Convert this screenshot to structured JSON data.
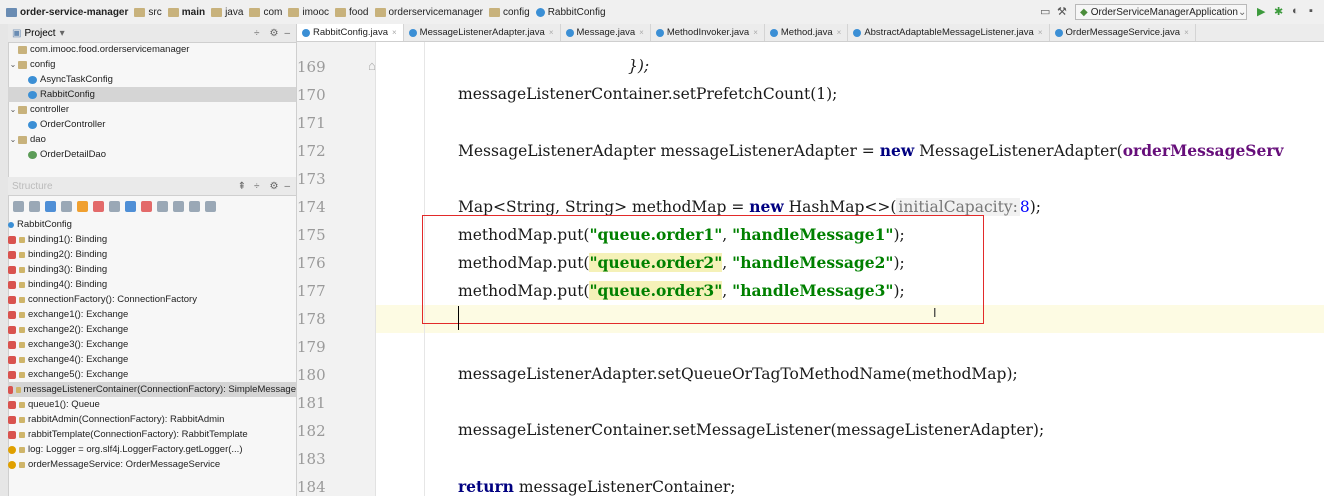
{
  "navbar": {
    "breadcrumbs": [
      "order-service-manager",
      "src",
      "main",
      "java",
      "com",
      "imooc",
      "food",
      "orderservicemanager",
      "config",
      "RabbitConfig"
    ],
    "run_config": "OrderServiceManagerApplication"
  },
  "left_panel": {
    "project_title": "Project",
    "project_tree": [
      {
        "label": "com.imooc.food.orderservicemanager",
        "icon": "folder-icon"
      },
      {
        "label": "config",
        "icon": "folder-icon"
      },
      {
        "label": "AsyncTaskConfig",
        "icon": "class-icon"
      },
      {
        "label": "RabbitConfig",
        "icon": "class-icon"
      },
      {
        "label": "controller",
        "icon": "folder-icon"
      },
      {
        "label": "OrderController",
        "icon": "class-icon"
      },
      {
        "label": "dao",
        "icon": "folder-icon"
      },
      {
        "label": "OrderDetailDao",
        "icon": "interface-icon"
      }
    ],
    "structure_title": "Structure",
    "structure_root": "RabbitConfig",
    "structure_items": [
      "binding1(): Binding",
      "binding2(): Binding",
      "binding3(): Binding",
      "binding4(): Binding",
      "connectionFactory(): ConnectionFactory",
      "exchange1(): Exchange",
      "exchange2(): Exchange",
      "exchange3(): Exchange",
      "exchange4(): Exchange",
      "exchange5(): Exchange",
      "messageListenerContainer(ConnectionFactory): SimpleMessage",
      "queue1(): Queue",
      "rabbitAdmin(ConnectionFactory): RabbitAdmin",
      "rabbitTemplate(ConnectionFactory): RabbitTemplate",
      "log: Logger = org.slf4j.LoggerFactory.getLogger(...)",
      "orderMessageService: OrderMessageService"
    ]
  },
  "tabs": [
    "RabbitConfig.java",
    "MessageListenerAdapter.java",
    "Message.java",
    "MethodInvoker.java",
    "Method.java",
    "AbstractAdaptableMessageListener.java",
    "OrderMessageService.java"
  ],
  "editor": {
    "line_numbers": [
      "169",
      "170",
      "171",
      "172",
      "173",
      "174",
      "175",
      "176",
      "177",
      "178",
      "179",
      "180",
      "181",
      "182",
      "183",
      "184"
    ],
    "l169": "});",
    "l170": "messageListenerContainer.setPrefetchCount(1);",
    "l172_a": "MessageListenerAdapter messageListenerAdapter = ",
    "l172_kw": "new",
    "l172_b": " MessageListenerAdapter(",
    "l172_c": "orderMessageServ",
    "l174_a": "Map<String, String> methodMap = ",
    "l174_kw": "new",
    "l174_b": " HashMap<>(",
    "l174_hint": "initialCapacity:",
    "l174_num": "8",
    "l174_c": ");",
    "put_prefix": "methodMap.put(",
    "q1": "\"queue.order1\"",
    "h1": "\"handleMessage1\"",
    "q2": "\"queue.order2\"",
    "h2": "\"handleMessage2\"",
    "q3": "\"queue.order3\"",
    "h3": "\"handleMessage3\"",
    "comma": ", ",
    "close": ");",
    "l180": "messageListenerAdapter.setQueueOrTagToMethodName(methodMap);",
    "l182": "messageListenerContainer.setMessageListener(messageListenerAdapter);",
    "l184_kw": "return",
    "l184_b": " messageListenerContainer;"
  }
}
